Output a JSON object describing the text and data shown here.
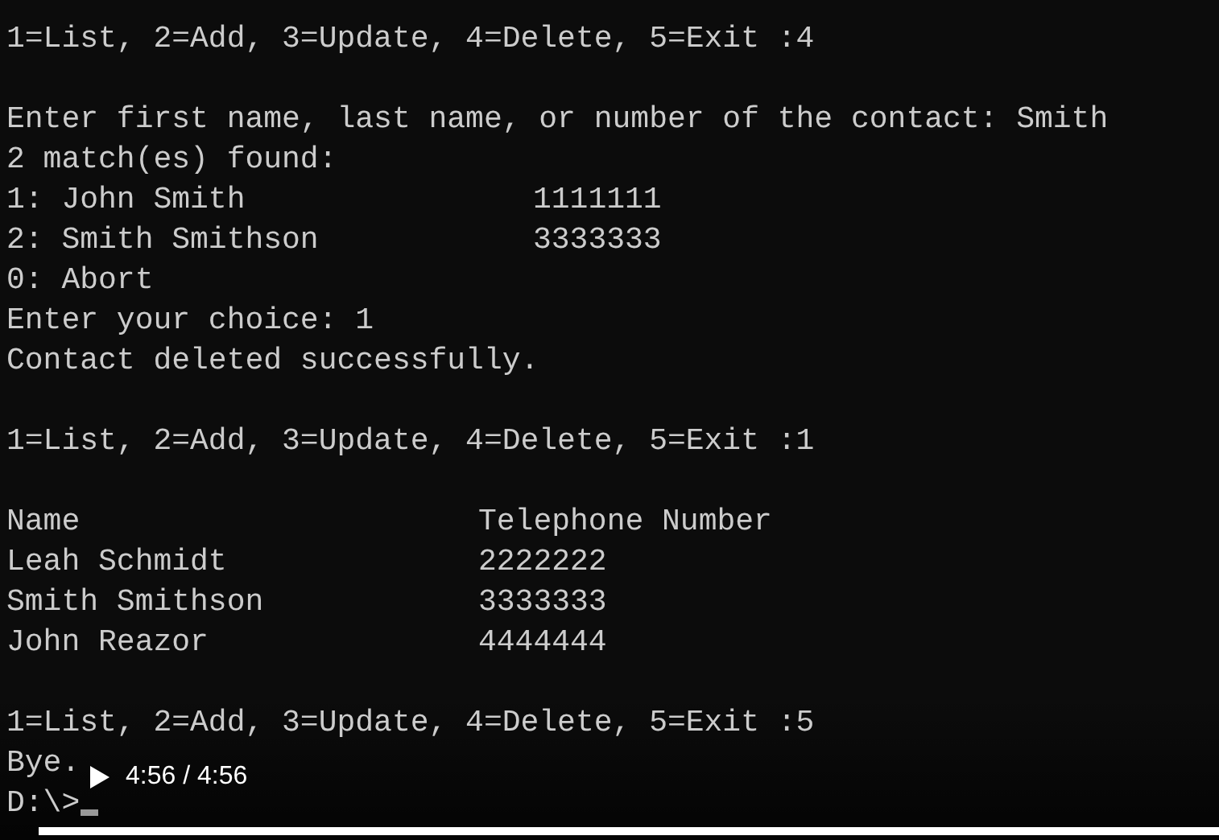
{
  "console": {
    "lines": [
      {
        "kind": "text",
        "text": "1=List, 2=Add, 3=Update, 4=Delete, 5=Exit :4"
      },
      {
        "kind": "blank"
      },
      {
        "kind": "text",
        "text": "Enter first name, last name, or number of the contact: Smith"
      },
      {
        "kind": "text",
        "text": "2 match(es) found:"
      },
      {
        "kind": "match_row",
        "cells": [
          "1: John Smith",
          "1111111"
        ]
      },
      {
        "kind": "match_row",
        "cells": [
          "2: Smith Smithson",
          "3333333"
        ]
      },
      {
        "kind": "text",
        "text": "0: Abort"
      },
      {
        "kind": "text",
        "text": "Enter your choice: 1"
      },
      {
        "kind": "text",
        "text": "Contact deleted successfully."
      },
      {
        "kind": "blank"
      },
      {
        "kind": "text",
        "text": "1=List, 2=Add, 3=Update, 4=Delete, 5=Exit :1"
      },
      {
        "kind": "blank"
      },
      {
        "kind": "table_row",
        "cells": [
          "Name",
          "Telephone Number"
        ]
      },
      {
        "kind": "table_row",
        "cells": [
          "Leah Schmidt",
          "2222222"
        ]
      },
      {
        "kind": "table_row",
        "cells": [
          "Smith Smithson",
          "3333333"
        ]
      },
      {
        "kind": "table_row",
        "cells": [
          "John Reazor",
          "4444444"
        ]
      },
      {
        "kind": "blank"
      },
      {
        "kind": "text",
        "text": "1=List, 2=Add, 3=Update, 4=Delete, 5=Exit :5"
      },
      {
        "kind": "text",
        "text": "Bye."
      },
      {
        "kind": "prompt",
        "text": "D:\\>"
      }
    ]
  },
  "player": {
    "time": "4:56 / 4:56",
    "progress": {
      "level": 1
    }
  }
}
